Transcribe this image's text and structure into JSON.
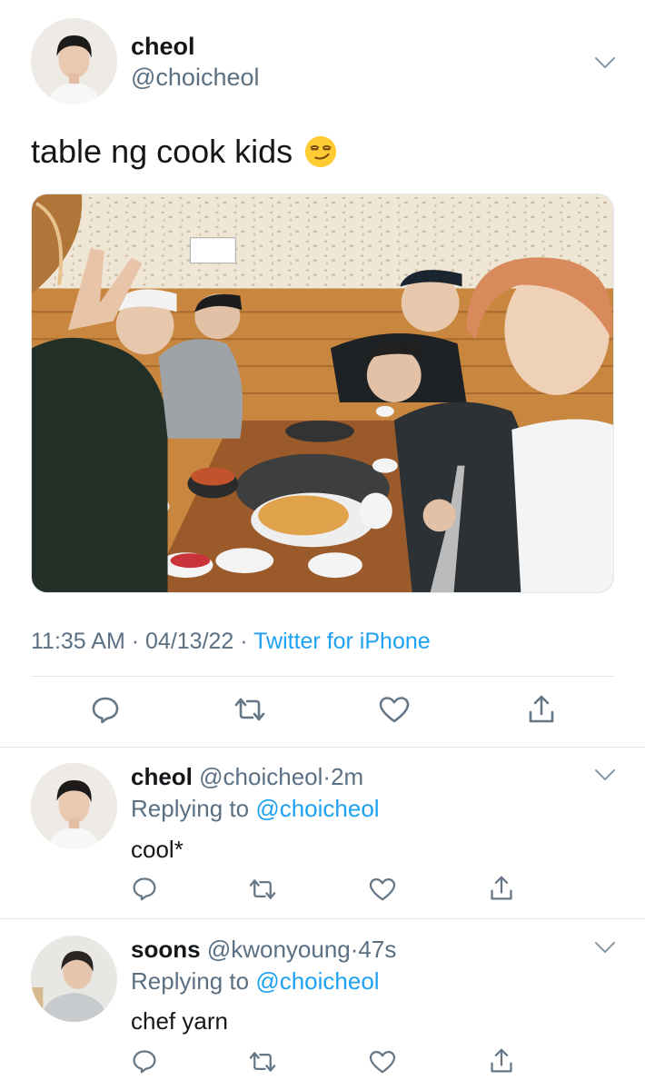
{
  "main_tweet": {
    "display_name": "cheol",
    "handle": "@choicheol",
    "text": "table ng cook kids",
    "emoji": "smirking-face-emoji",
    "time": "11:35 AM",
    "date": "04/13/22",
    "separator": "·",
    "source": "Twitter for iPhone",
    "actions": [
      "reply-icon",
      "retweet-icon",
      "like-icon",
      "share-icon"
    ]
  },
  "replies": [
    {
      "display_name": "cheol",
      "handle": "@choicheol",
      "separator": "·",
      "age": "2m",
      "replying_prefix": "Replying to",
      "replying_to": "@choicheol",
      "text": "cool*"
    },
    {
      "display_name": "soons",
      "handle": "@kwonyoung",
      "separator": "·",
      "age": "47s",
      "replying_prefix": "Replying to",
      "replying_to": "@choicheol",
      "text": "chef yarn"
    }
  ],
  "colors": {
    "text": "#14171a",
    "secondary": "#5b7083",
    "link": "#1da1f2",
    "divider": "#e1e8ed",
    "icon": "#657786"
  }
}
